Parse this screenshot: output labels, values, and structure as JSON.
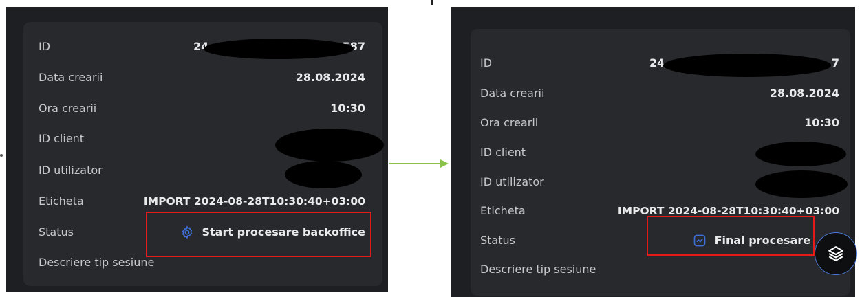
{
  "colors": {
    "panel_bg": "#1e1f22",
    "card_bg": "#27292c",
    "highlight_box": "#e31b1b",
    "arrow": "#8bc34a",
    "status_icon": "#3f6fd6"
  },
  "before": {
    "id_label": "ID",
    "id_value_start": "24",
    "id_value_end": "587",
    "date_label": "Data crearii",
    "date_value": "28.08.2024",
    "time_label": "Ora crearii",
    "time_value": "10:30",
    "client_label": "ID client",
    "user_label": "ID utilizator",
    "tag_label": "Eticheta",
    "tag_value": "IMPORT 2024-08-28T10:30:40+03:00",
    "status_label": "Status",
    "status_icon": "gear-icon",
    "status_value": "Start procesare backoffice",
    "desc_label": "Descriere tip sesiune"
  },
  "after": {
    "id_label": "ID",
    "id_value_start": "24",
    "id_value_end": "7",
    "date_label": "Data crearii",
    "date_value": "28.08.2024",
    "time_label": "Ora crearii",
    "time_value": "10:30",
    "client_label": "ID client",
    "user_label": "ID utilizator",
    "tag_label": "Eticheta",
    "tag_value": "IMPORT 2024-08-28T10:30:40+03:00",
    "status_label": "Status",
    "status_icon": "check-chart-icon",
    "status_value": "Final procesare",
    "desc_label": "Descriere tip sesiune",
    "fab_icon": "layers-icon"
  }
}
